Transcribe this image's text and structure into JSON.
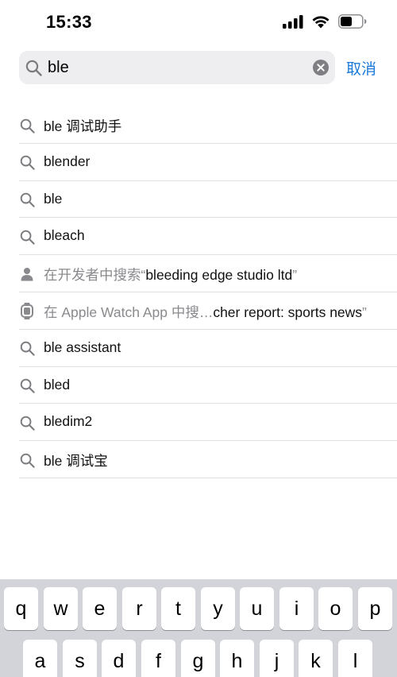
{
  "status_bar": {
    "time": "15:33"
  },
  "search": {
    "value": "ble",
    "cancel_label": "取消"
  },
  "suggestions": [
    {
      "icon": "search-icon",
      "text": "ble 调试助手"
    },
    {
      "icon": "search-icon",
      "text": "blender"
    },
    {
      "icon": "search-icon",
      "text": "ble"
    },
    {
      "icon": "search-icon",
      "text": "bleach"
    },
    {
      "icon": "person-icon",
      "prefix": "在开发者中搜索“",
      "text": "bleeding edge studio ltd",
      "suffix": "”"
    },
    {
      "icon": "watch-icon",
      "prefix": "在 Apple Watch App 中搜…",
      "text": "cher report: sports news",
      "suffix": "”"
    },
    {
      "icon": "search-icon",
      "text": "ble assistant"
    },
    {
      "icon": "search-icon",
      "text": "bled"
    },
    {
      "icon": "search-icon",
      "text": "bledim2"
    },
    {
      "icon": "search-icon",
      "text": "ble 调试宝"
    }
  ],
  "keyboard": {
    "row1": [
      "q",
      "w",
      "e",
      "r",
      "t",
      "y",
      "u",
      "i",
      "o",
      "p"
    ],
    "row2": [
      "a",
      "s",
      "d",
      "f",
      "g",
      "h",
      "j",
      "k",
      "l"
    ]
  },
  "colors": {
    "accent": "#1a7ad8",
    "search_field_bg": "#eeeef0",
    "keyboard_bg": "#d2d4d9",
    "muted_text": "#8a8a8e"
  }
}
